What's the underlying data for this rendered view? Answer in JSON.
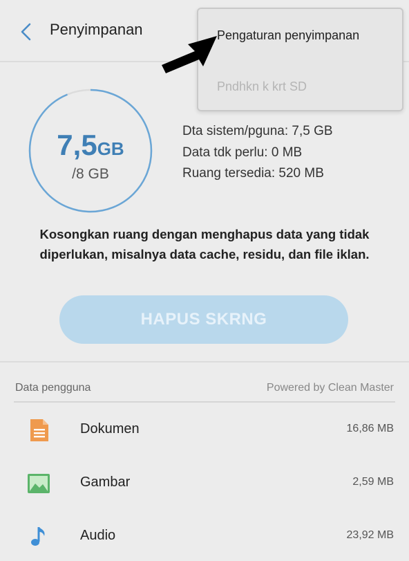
{
  "header": {
    "title": "Penyimpanan"
  },
  "menu": {
    "items": [
      {
        "label": "Pengaturan penyimpanan",
        "enabled": true
      },
      {
        "label": "Pndhkn k krt SD",
        "enabled": false
      }
    ]
  },
  "storage": {
    "used_value": "7,5",
    "used_unit": "GB",
    "total": "/8 GB",
    "used_fraction": 0.9375,
    "ring_color": "#6aa6d6"
  },
  "stats": {
    "system": "Dta sistem/pguna: 7,5 GB",
    "unnecessary": "Data tdk perlu: 0 MB",
    "available": "Ruang tersedia: 520 MB"
  },
  "description": "Kosongkan ruang dengan menghapus data yang tidak diperlukan, misalnya data cache, residu, dan file iklan.",
  "clean_button": {
    "label": "HAPUS SKRNG",
    "enabled": false
  },
  "user_data": {
    "section_title": "Data pengguna",
    "powered_by": "Powered by Clean Master",
    "items": [
      {
        "label": "Dokumen",
        "size": "16,86 MB",
        "icon": "document-icon",
        "color": "#ef9a4e"
      },
      {
        "label": "Gambar",
        "size": "2,59 MB",
        "icon": "image-icon",
        "color": "#5bb46a"
      },
      {
        "label": "Audio",
        "size": "23,92 MB",
        "icon": "music-note-icon",
        "color": "#3f8fd6"
      }
    ]
  },
  "colors": {
    "accent": "#3f7fb5",
    "button_disabled": "#b9d8ec",
    "background": "#ececec"
  }
}
